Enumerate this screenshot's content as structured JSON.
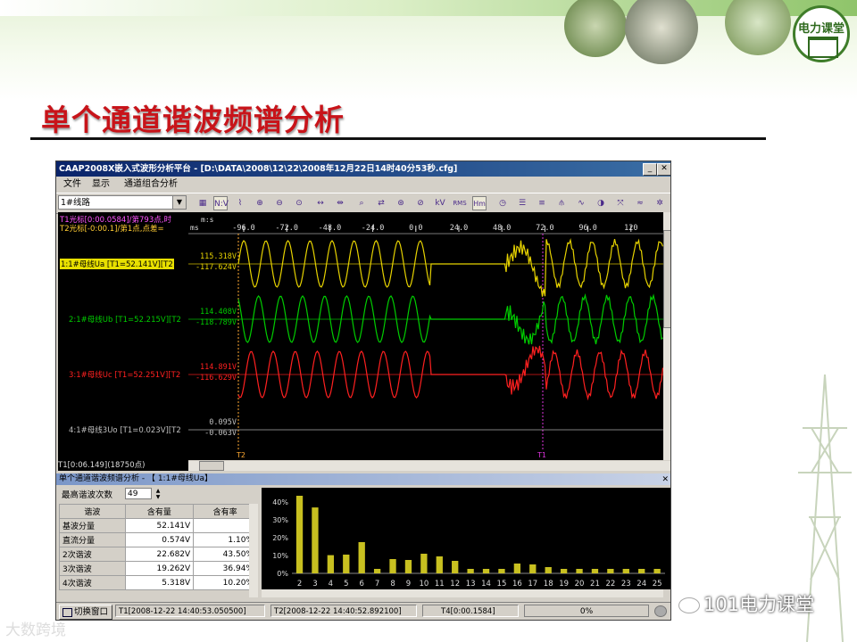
{
  "slide": {
    "title": "单个通道谐波频谱分析",
    "logo_text": "电力课堂",
    "watermark_left": "大数跨境",
    "watermark_right": "101电力课堂"
  },
  "window": {
    "title": "CAAP2008X嵌入式波形分析平台 - [D:\\DATA\\2008\\12\\22\\2008年12月22日14时40分53秒.cfg]",
    "menu": [
      "文件",
      "显示",
      "通道组合分析"
    ],
    "channel_select": "1#线路",
    "toolbar_icons": [
      "color-palette-icon",
      "nv-icon",
      "envelope-icon",
      "zoom-in-icon",
      "zoom-out-icon",
      "zoom-fit-icon",
      "expand-horizontal-icon",
      "compress-horizontal-icon",
      "search-icon",
      "swap-icon",
      "magnify-plus-icon",
      "magnify-minus-icon",
      "kv-icon",
      "rms-icon",
      "harmonic-icon",
      "clock-icon",
      "list-icon",
      "list-alt-icon",
      "filter-icon",
      "phasor-icon",
      "circle-icon",
      "vector-icon",
      "wave-icon",
      "settings-icon"
    ],
    "toolbar_labels": {
      "nv": "N:V",
      "kv": "kV",
      "rms": "RMS",
      "hm": "Hm"
    }
  },
  "waveform": {
    "cursor_t1": "T1光标[0:00.0584]/第793点,时",
    "cursor_t2": "T2光标[-0:00.1]/第1点,点差=",
    "axis_unit_top": "m:s",
    "axis_unit": "ms",
    "time_ticks": [
      "-96.0",
      "-72.0",
      "-48.0",
      "-24.0",
      "0.0",
      "24.0",
      "48.0",
      "72.0",
      "96.0",
      "120"
    ],
    "marker_t2": "T2",
    "marker_t1": "T1",
    "channels": [
      {
        "label": "1:1#母线Ua [T1=52.141V][T2",
        "max": "115.318V",
        "min": "-117.624V",
        "color": "#e6d200"
      },
      {
        "label": "2:1#母线Ub [T1=52.215V][T2",
        "max": "114.408V",
        "min": "-118.789V",
        "color": "#00cc00"
      },
      {
        "label": "3:1#母线Uc [T1=52.251V][T2",
        "max": "114.891V",
        "min": "-116.629V",
        "color": "#ff2020"
      },
      {
        "label": "4:1#母线3Uo [T1=0.023V][T2",
        "max": "0.095V",
        "min": "-0.063V",
        "color": "#c0c0c0"
      }
    ],
    "status": "T1[0:06.149](18750点)"
  },
  "spectrum": {
    "panel_title": "单个通道谐波频谱分析 - 【  1:1#母线Ua】",
    "max_order_label": "最高谐波次数",
    "max_order_value": "49",
    "table_headers": [
      "谐波",
      "含有量",
      "含有率"
    ],
    "table_rows": [
      [
        "基波分量",
        "52.141V",
        ""
      ],
      [
        "直流分量",
        "0.574V",
        "1.10%"
      ],
      [
        "2次谐波",
        "22.682V",
        "43.50%"
      ],
      [
        "3次谐波",
        "19.262V",
        "36.94%"
      ],
      [
        "4次谐波",
        "5.318V",
        "10.20%"
      ]
    ]
  },
  "statusbar": {
    "switch_button": "切换窗口",
    "t1": "T1[2008-12-22 14:40:53.050500]",
    "t2": "T2[2008-12-22 14:40:52.892100]",
    "t4": "T4[0:00.1584]",
    "progress": "0%"
  },
  "chart_data": {
    "type": "bar",
    "title": "",
    "xlabel": "",
    "ylabel": "",
    "ylim": [
      0,
      45
    ],
    "yticks": [
      "0%",
      "10%",
      "20%",
      "30%",
      "40%"
    ],
    "categories": [
      "2",
      "3",
      "4",
      "5",
      "6",
      "7",
      "8",
      "9",
      "10",
      "11",
      "12",
      "13",
      "14",
      "15",
      "16",
      "17",
      "18",
      "19",
      "20",
      "21",
      "22",
      "23",
      "24",
      "25"
    ],
    "values": [
      43.5,
      36.94,
      10.2,
      10.5,
      17.5,
      2.5,
      8.0,
      7.5,
      11.0,
      9.5,
      7.0,
      2.5,
      2.5,
      2.5,
      5.5,
      5.0,
      3.5,
      2.5,
      2.5,
      2.5,
      2.5,
      2.5,
      2.5,
      2.5
    ],
    "bar_color": "#c8c020",
    "grid": false
  }
}
